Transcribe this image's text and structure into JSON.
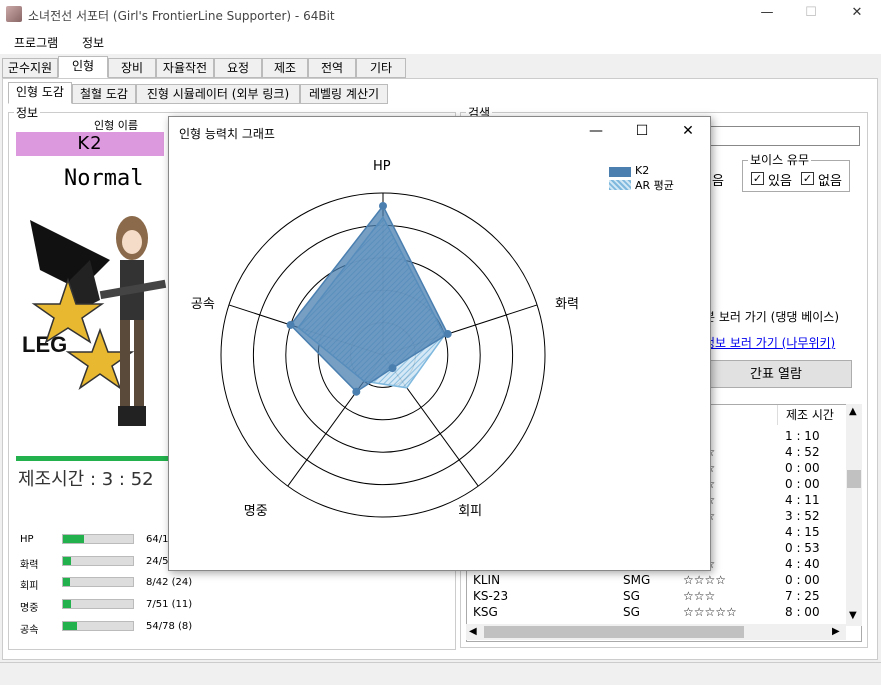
{
  "window": {
    "title": "소녀전선 서포터 (Girl's FrontierLine Supporter) - 64Bit",
    "minimize": "—",
    "maximize": "☐",
    "close": "✕"
  },
  "menu": [
    "프로그램",
    "정보"
  ],
  "main_tabs": [
    "군수지원",
    "인형",
    "장비",
    "자율작전",
    "요정",
    "제조",
    "전역",
    "기타"
  ],
  "sub_tabs": [
    "인형 도감",
    "철혈 도감",
    "진형 시뮬레이터 (외부 링크)",
    "레벨링 계산기"
  ],
  "info": {
    "group_label": "정보",
    "name_label": "인형 이름",
    "name": "K2",
    "rarity": "Normal",
    "build_time": "제조시간 : 3 : 52",
    "stats": [
      {
        "label": "HP",
        "value_text": "64/1",
        "fill": 0.3
      },
      {
        "label": "화력",
        "value_text": "24/5",
        "fill": 0.12
      },
      {
        "label": "회피",
        "value_text": "8/42 (24)",
        "fill": 0.1
      },
      {
        "label": "명중",
        "value_text": "7/51 (11)",
        "fill": 0.12
      },
      {
        "label": "공속",
        "value_text": "54/78 (8)",
        "fill": 0.2
      }
    ]
  },
  "search": {
    "group_label": "검색",
    "value": "",
    "voice_label": "보이스 유무",
    "voice_yes": "있음",
    "voice_no": "없음",
    "partial_left_check": "음",
    "link1": "본 보러 가기 (댕댕 베이스)",
    "link2": "정보 보러 가기 (나무위키)",
    "table_btn": "간표 열람"
  },
  "table": {
    "header_build": "제조 시간",
    "rows": [
      {
        "name": "",
        "type": "",
        "stars": "",
        "time": "1 : 10"
      },
      {
        "name": "",
        "type": "",
        "stars": "☆☆☆",
        "time": "4 : 52"
      },
      {
        "name": "",
        "type": "",
        "stars": "☆☆☆",
        "time": "0 : 00"
      },
      {
        "name": "",
        "type": "",
        "stars": "☆☆☆",
        "time": "0 : 00"
      },
      {
        "name": "",
        "type": "",
        "stars": "☆☆☆",
        "time": "4 : 11"
      },
      {
        "name": "",
        "type": "",
        "stars": "☆☆☆",
        "time": "3 : 52"
      },
      {
        "name": "",
        "type": "",
        "stars": "☆☆",
        "time": "4 : 15"
      },
      {
        "name": "",
        "type": "",
        "stars": "☆☆",
        "time": "0 : 53"
      },
      {
        "name": "",
        "type": "",
        "stars": "☆☆☆",
        "time": "4 : 40"
      },
      {
        "name": "KLIN",
        "type": "SMG",
        "stars": "☆☆☆☆",
        "time": "0 : 00"
      },
      {
        "name": "KS-23",
        "type": "SG",
        "stars": "☆☆☆",
        "time": "7 : 25"
      },
      {
        "name": "KSG",
        "type": "SG",
        "stars": "☆☆☆☆☆",
        "time": "8 : 00"
      }
    ]
  },
  "popup": {
    "title": "인형 능력치 그래프",
    "minimize": "—",
    "maximize": "☐",
    "close": "✕"
  },
  "chart_data": {
    "type": "radar",
    "axes": [
      "HP",
      "화력",
      "회피",
      "명중",
      "공속"
    ],
    "rlim": [
      0,
      1
    ],
    "rings": 5,
    "series": [
      {
        "name": "K2",
        "values": [
          0.92,
          0.42,
          0.1,
          0.28,
          0.6
        ],
        "color": "#4a7fb0"
      },
      {
        "name": "AR 평균",
        "values": [
          0.85,
          0.4,
          0.25,
          0.2,
          0.55
        ],
        "color": "#7fb8dd",
        "pattern": "hatched"
      }
    ],
    "legend_position": "top-right"
  },
  "colors": {
    "name_bg": "#dd99dd",
    "stat_fill": "#22b14c",
    "link": "#0000ee"
  }
}
